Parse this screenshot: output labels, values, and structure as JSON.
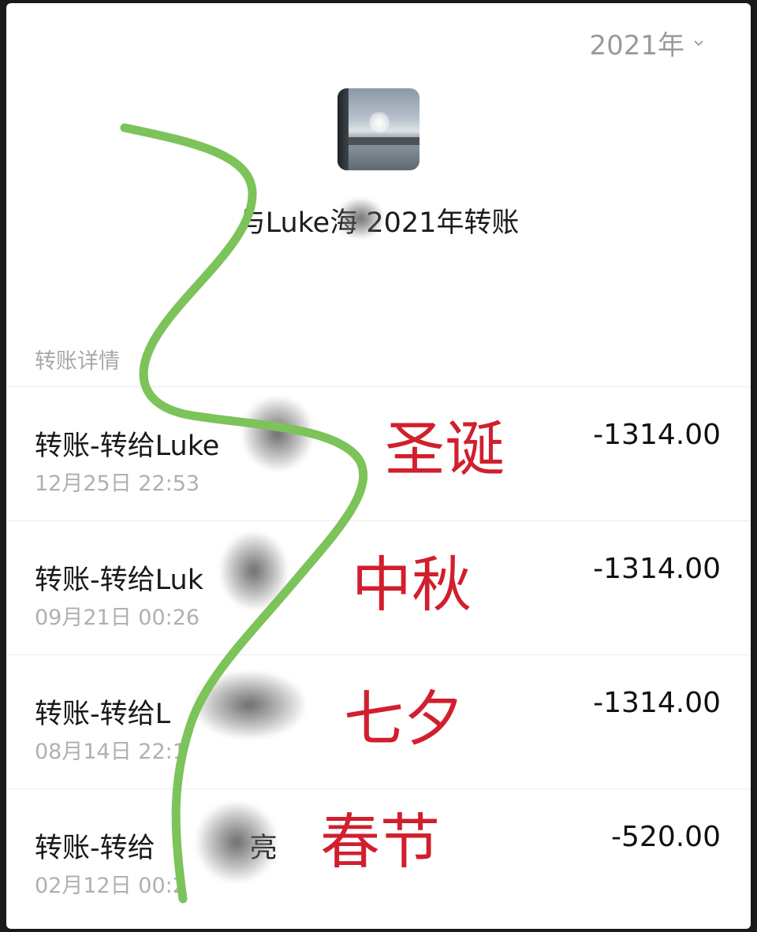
{
  "header": {
    "year_selector": "2021年"
  },
  "peer_title": "与Luke海 2021年转账",
  "section_label": "转账详情",
  "transactions": [
    {
      "title": "转账-转给Luke",
      "time": "12月25日 22:53",
      "amount": "-1314.00"
    },
    {
      "title": "转账-转给Luk",
      "time": "09月21日 00:26",
      "amount": "-1314.00"
    },
    {
      "title": "转账-转给L",
      "time": "08月14日 22:1",
      "amount": "-1314.00"
    },
    {
      "title": "转账-转给",
      "title_suffix": "亮",
      "time": "02月12日 00:2",
      "amount": "-520.00"
    }
  ],
  "annotations": [
    "圣诞",
    "中秋",
    "七夕",
    "春节"
  ],
  "colors": {
    "annotation_red": "#d11f2d",
    "scribble_green": "#7cc35a"
  }
}
